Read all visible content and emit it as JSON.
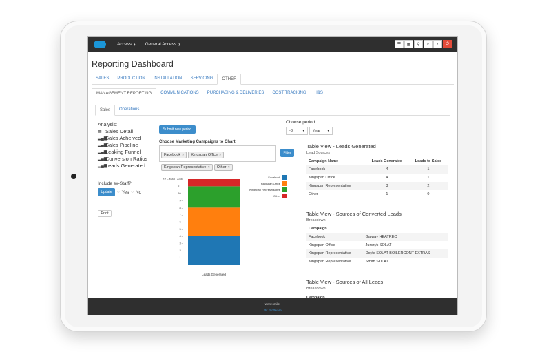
{
  "header": {
    "breadcrumbs": [
      "Access",
      "General Access"
    ],
    "tools": [
      "list-icon",
      "grid-icon",
      "pin-icon",
      "search-icon",
      "contrast-icon",
      "power-icon"
    ]
  },
  "page": {
    "title": "Reporting Dashboard"
  },
  "tabs_main": [
    "SALES",
    "PRODUCTION",
    "INSTALLATION",
    "SERVICING",
    "OTHER"
  ],
  "tabs_main_active": "OTHER",
  "tabs_sub": [
    "MANAGEMENT REPORTING",
    "COMMUNICATIONS",
    "PURCHASING & DELIVERIES",
    "COST TRACKING",
    "H&S"
  ],
  "tabs_sub_active": "MANAGEMENT REPORTING",
  "tabs_third": [
    "Sales",
    "Operations"
  ],
  "tabs_third_active": "Sales",
  "analysis": {
    "label": "Analysis:",
    "items": [
      "Sales Detail",
      "Sales Acheived",
      "Sales Pipeline",
      "Leaking Funnel",
      "Conversion Ratios",
      "Leads Generated"
    ]
  },
  "staff": {
    "label": "Include ex-Staff?",
    "update": "Update",
    "yes": "Yes",
    "no": "No"
  },
  "print_label": "Print",
  "submit_label": "Submit new period",
  "period": {
    "label": "Choose period",
    "value": "-3",
    "unit": "Year"
  },
  "campaigns": {
    "label": "Choose Marketing Campaigns to Chart",
    "tags": [
      "Facebook",
      "Kingspan Office",
      "Kingspan Representative",
      "Other"
    ],
    "filter": "Filter"
  },
  "chart_data": {
    "type": "bar",
    "stacked": true,
    "categories": [
      "Leads Generated"
    ],
    "xlabel": "Leads Generated",
    "ylim": [
      0,
      12
    ],
    "top_label": "12 – Total Leads",
    "series": [
      {
        "name": "Facebook",
        "values": [
          4
        ],
        "color": "#1f77b4"
      },
      {
        "name": "Kingspan Office",
        "values": [
          4
        ],
        "color": "#ff7f0e"
      },
      {
        "name": "Kingspan Representative",
        "values": [
          3
        ],
        "color": "#2ca02c"
      },
      {
        "name": "Other",
        "values": [
          1
        ],
        "color": "#d62728"
      }
    ]
  },
  "leads_table": {
    "title": "Table View - Leads Generated",
    "subtitle": "Lead Sources",
    "headers": [
      "Campaign Name",
      "Leads Generated",
      "Leads to Sales"
    ],
    "rows": [
      [
        "Facebook",
        "4",
        "1"
      ],
      [
        "Kingspan Office",
        "4",
        "1"
      ],
      [
        "Kingspan Representative",
        "3",
        "2"
      ],
      [
        "Other",
        "1",
        "0"
      ]
    ]
  },
  "converted_table": {
    "title": "Table View - Sources of Converted Leads",
    "subtitle": "Breakdown",
    "headers": [
      "Campaign"
    ],
    "rows": [
      [
        "Facebook",
        "Galway HEATREC"
      ],
      [
        "Kingspan Office",
        "Jurczyk SOLAT"
      ],
      [
        "Kingspan Representative",
        "Doyle SOLAT BOILERCONT EXTRAS"
      ],
      [
        "Kingspan Representative",
        "Smith SOLAT"
      ]
    ]
  },
  "all_table": {
    "title": "Table View - Sources of All Leads",
    "subtitle": "Breakdown",
    "headers": [
      "Campaign"
    ]
  },
  "footer": {
    "line1": "www.smile.",
    "line2": "Pit. Software"
  }
}
